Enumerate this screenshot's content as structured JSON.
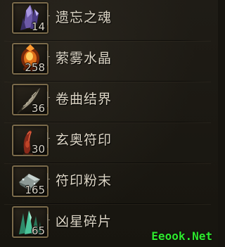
{
  "items": [
    {
      "name": "遗忘之魂",
      "quantity": "14",
      "icon": "purple-crystal-icon"
    },
    {
      "name": "萦雾水晶",
      "quantity": "258",
      "icon": "fire-crystal-icon"
    },
    {
      "name": "卷曲结界",
      "quantity": "36",
      "icon": "feather-icon"
    },
    {
      "name": "玄奥符印",
      "quantity": "30",
      "icon": "red-rune-icon"
    },
    {
      "name": "符印粉末",
      "quantity": "165",
      "icon": "dust-powder-icon"
    },
    {
      "name": "凶星碎片",
      "quantity": "65",
      "icon": "green-shard-icon"
    }
  ],
  "watermark": "Eeook.Net",
  "colors": {
    "slot_border": "#7a6a4a",
    "text": "#ddd6c6",
    "watermark": "#2ee82e"
  }
}
